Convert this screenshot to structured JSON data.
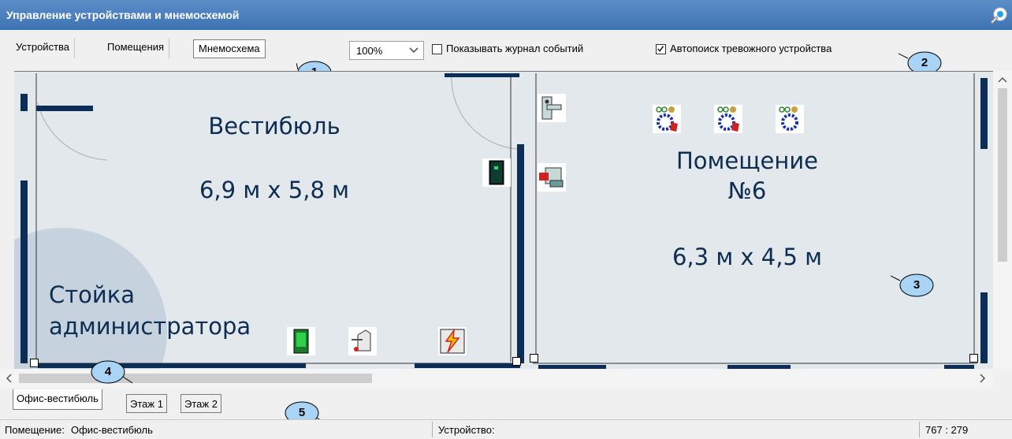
{
  "window": {
    "title": "Управление устройствами и мнемосхемой",
    "help_icon": "help-wizard-icon"
  },
  "toolbar": {
    "tabs": [
      {
        "label": "Устройства",
        "active": false
      },
      {
        "label": "Помещения",
        "active": false
      },
      {
        "label": "Мнемосхема",
        "active": true
      }
    ],
    "zoom": {
      "value": "100%"
    },
    "show_event_log": {
      "label": "Показывать журнал событий",
      "checked": false
    },
    "auto_search_alarm": {
      "label": "Автопоиск тревожного устройства",
      "checked": true
    }
  },
  "callouts": [
    "1",
    "2",
    "3",
    "4",
    "5"
  ],
  "plan": {
    "rooms": [
      {
        "title": "Вестибюль",
        "size": "6,9 м х 5,8 м"
      },
      {
        "title_line1": "Помещение",
        "title_line2": "№6",
        "size": "6,3 м х 4,5 м"
      }
    ],
    "desk_label_line1": "Стойка",
    "desk_label_line2": "администратора",
    "devices": [
      "terminal-device-icon",
      "card-reader-device-icon",
      "turnstile-device-icon",
      "fire-alarm-device-icon",
      "door-lock-device-icon",
      "controller-device-icon",
      "sensor-alarm-device-icon",
      "sensor-alarm-device-icon",
      "sensor-device-icon"
    ]
  },
  "bottom_tabs": [
    {
      "label": "Офис-вестибюль",
      "active": true
    },
    {
      "label": "Этаж 1",
      "active": false
    },
    {
      "label": "Этаж 2",
      "active": false
    }
  ],
  "status": {
    "room_label": "Помещение:",
    "room_value": "Офис-вестибюль",
    "device_label": "Устройство:",
    "device_value": "",
    "coords": "767 : 279"
  },
  "colors": {
    "titlebar": "#4a7fbe",
    "wall": "#0d2d59",
    "floor": "#e3e8ec",
    "callout": "#a9d4f5"
  }
}
